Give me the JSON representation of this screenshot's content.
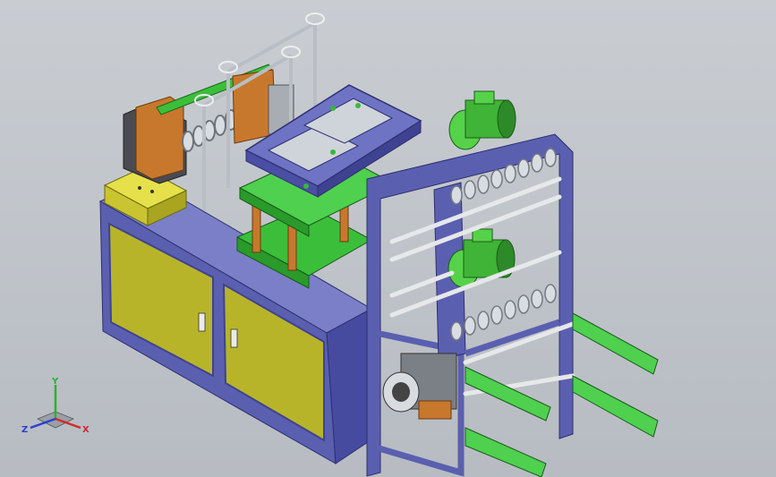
{
  "viewport": {
    "background": "#bfc3c8",
    "model_colors": {
      "frame_blue": "#5a5fb0",
      "frame_blue_dark": "#3f4390",
      "cabinet_yellow": "#b8b42a",
      "accent_green": "#3bbf3b",
      "motor_green": "#56d24a",
      "copper": "#c8782d",
      "steel": "#9aa3aa"
    }
  },
  "triad": {
    "x_label": "X",
    "y_label": "Y",
    "z_label": "Z",
    "x_color": "#d12a2a",
    "y_color": "#2bb22b",
    "z_color": "#2a3fd1"
  }
}
